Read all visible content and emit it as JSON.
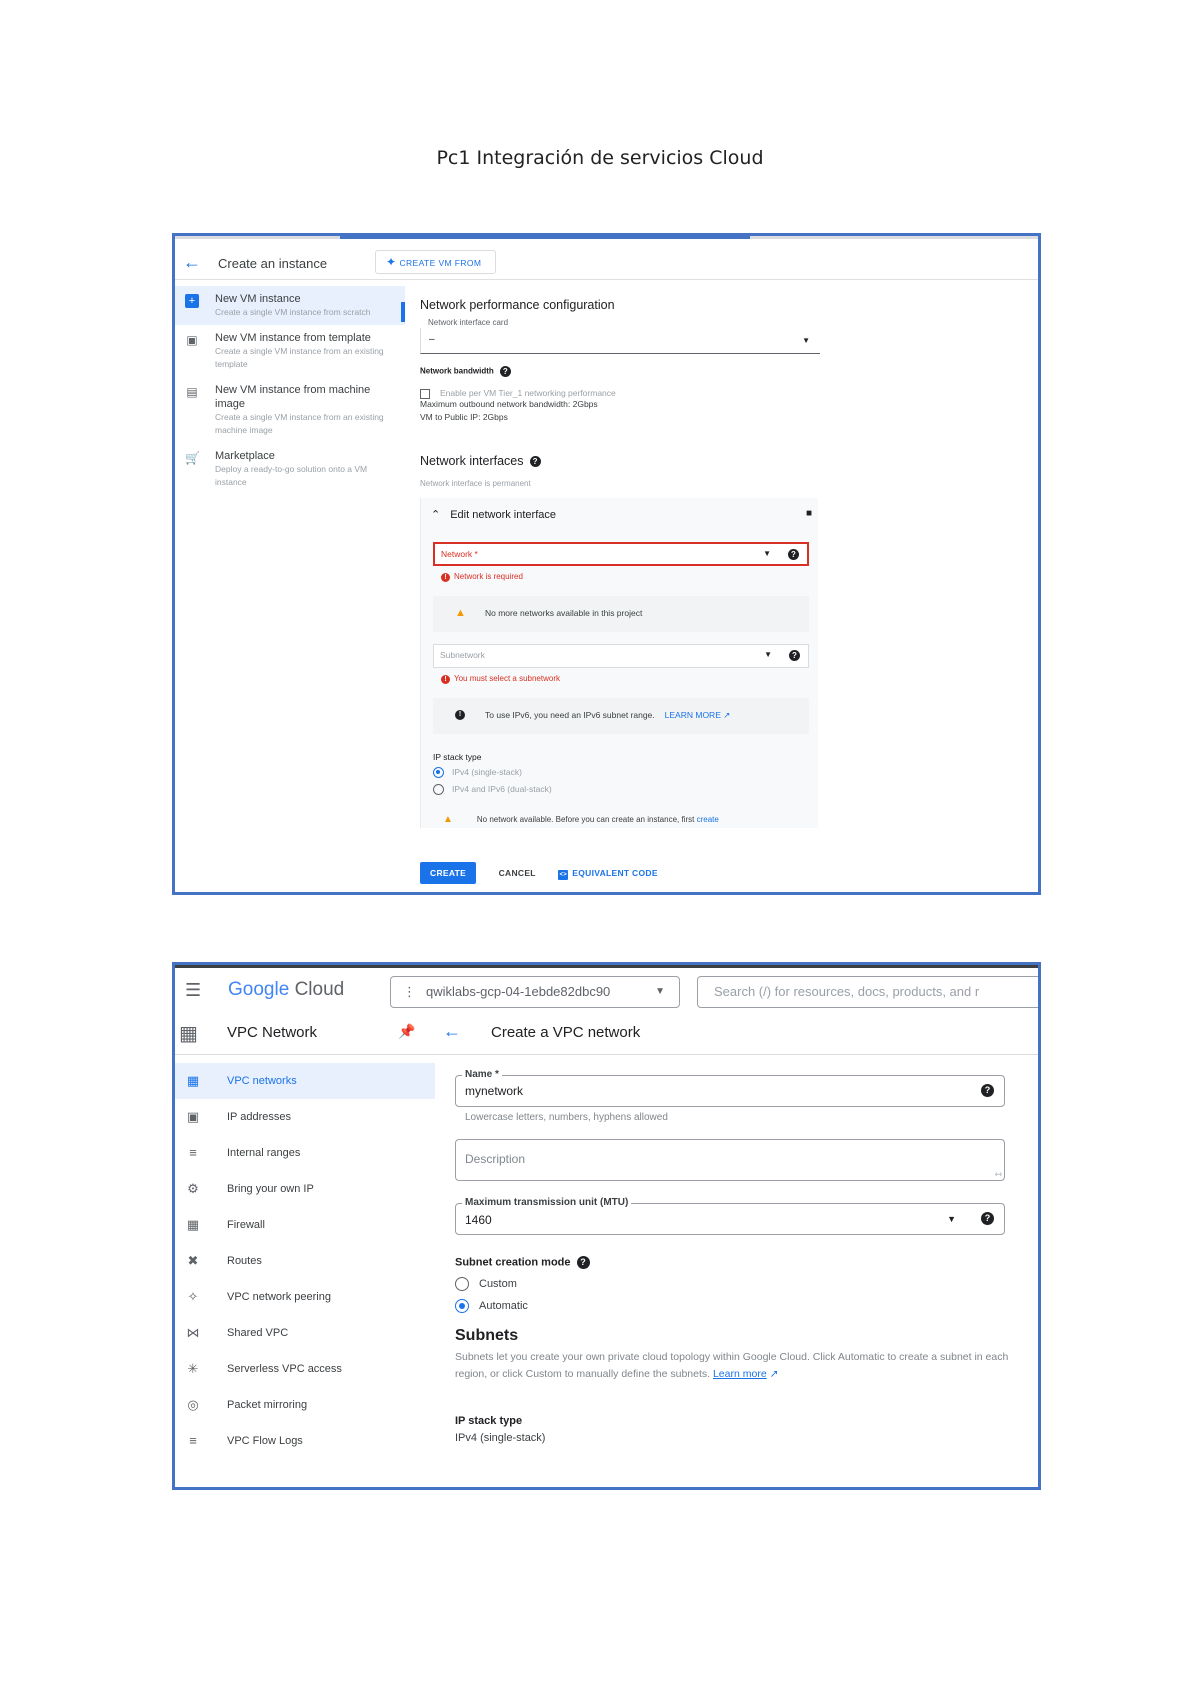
{
  "document": {
    "title": "Pc1 Integración de servicios Cloud"
  },
  "shot1": {
    "header": {
      "title": "Create an instance",
      "vm_from_button": "CREATE VM FROM"
    },
    "sidebar": {
      "items": [
        {
          "title": "New VM instance",
          "desc": "Create a single VM instance from scratch"
        },
        {
          "title": "New VM instance from template",
          "desc": "Create a single VM instance from an existing template"
        },
        {
          "title": "New VM instance from machine image",
          "desc": "Create a single VM instance from an existing machine image"
        },
        {
          "title": "Marketplace",
          "desc": "Deploy a ready-to-go solution onto a VM instance"
        }
      ]
    },
    "main": {
      "perf_heading": "Network performance configuration",
      "nic_label": "Network interface card",
      "nic_value": "–",
      "bandwidth_label": "Network bandwidth",
      "tier1_checkbox": "Enable per VM Tier_1 networking performance",
      "max_bandwidth": "Maximum outbound network bandwidth: 2Gbps",
      "vm_public": "VM to Public IP: 2Gbps",
      "interfaces_heading": "Network interfaces",
      "interfaces_sub": "Network interface is permanent"
    },
    "card": {
      "edit_title": "Edit network interface",
      "network_label": "Network *",
      "network_error": "Network is required",
      "no_networks": "No more networks available in this project",
      "subnetwork_label": "Subnetwork",
      "subnetwork_error": "You must select a subnetwork",
      "ipv6_notice": "To use IPv6, you need an IPv6 subnet range.",
      "learn_more": "LEARN MORE",
      "ip_stack_label": "IP stack type",
      "ipv4_option": "IPv4 (single-stack)",
      "dual_option": "IPv4 and IPv6 (dual-stack)",
      "no_network_warning": "No network available. Before you can create an instance, first",
      "create_link": "create"
    },
    "footer": {
      "create": "CREATE",
      "cancel": "CANCEL",
      "equivalent": "EQUIVALENT CODE"
    }
  },
  "shot2": {
    "topbar": {
      "logo_word1": "Google",
      "logo_word2": "Cloud",
      "project": "qwiklabs-gcp-04-1ebde82dbc90",
      "search_placeholder": "Search (/) for resources, docs, products, and r"
    },
    "section": {
      "product": "VPC Network",
      "page_title": "Create a VPC network"
    },
    "sidebar": {
      "items": [
        "VPC networks",
        "IP addresses",
        "Internal ranges",
        "Bring your own IP",
        "Firewall",
        "Routes",
        "VPC network peering",
        "Shared VPC",
        "Serverless VPC access",
        "Packet mirroring",
        "VPC Flow Logs"
      ]
    },
    "form": {
      "name_label": "Name *",
      "name_value": "mynetwork",
      "name_hint": "Lowercase letters, numbers, hyphens allowed",
      "description_placeholder": "Description",
      "mtu_label": "Maximum transmission unit (MTU)",
      "mtu_value": "1460",
      "subnet_mode_label": "Subnet creation mode",
      "custom_option": "Custom",
      "automatic_option": "Automatic",
      "subnets_heading": "Subnets",
      "subnets_text": "Subnets let you create your own private cloud topology within Google Cloud. Click Automatic to create a subnet in each region, or click Custom to manually define the subnets.",
      "learn_more": "Learn more",
      "ip_stack_label": "IP stack type",
      "ip_stack_value": "IPv4 (single-stack)"
    }
  }
}
